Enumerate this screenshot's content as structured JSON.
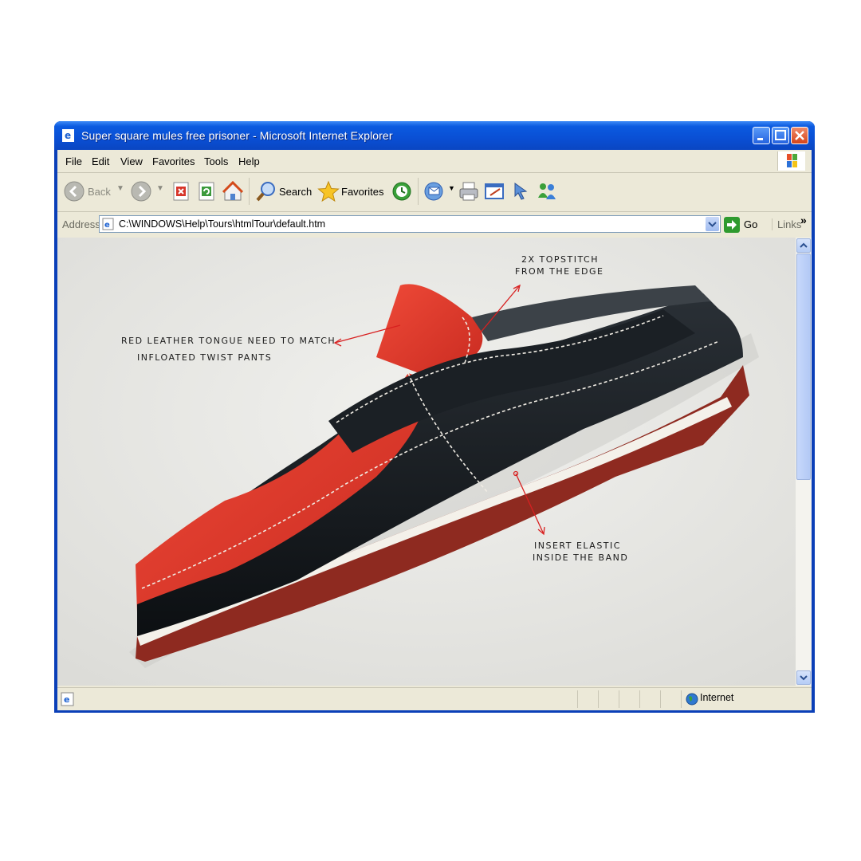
{
  "window": {
    "title": "Super square mules free prisoner - Microsoft Internet Explorer"
  },
  "menu": [
    "File",
    "Edit",
    "View",
    "Favorites",
    "Tools",
    "Help"
  ],
  "toolbar": {
    "back_label": "Back",
    "search_label": "Search",
    "favorites_label": "Favorites"
  },
  "address": {
    "label": "Address",
    "value": "C:\\WINDOWS\\Help\\Tours\\htmlTour\\default.htm",
    "go_label": "Go",
    "links_label": "Links"
  },
  "annotations": {
    "topstitch_1": "2X TOPSTITCH",
    "topstitch_2": "FROM THE EDGE",
    "tongue_1": "RED LEATHER TONGUE NEED TO MATCH",
    "tongue_2": "INFLOATED TWIST PANTS",
    "elastic_1": "INSERT ELASTIC",
    "elastic_2": "INSIDE THE BAND"
  },
  "status": {
    "zone": "Internet"
  },
  "colors": {
    "titlebar": "#0a4fd4",
    "chrome": "#ece9d8",
    "shoe_red": "#e0342a",
    "shoe_black": "#14181c",
    "sole": "#9a2c22",
    "annotation_arrow": "#d82020"
  },
  "icons": [
    "ie-icon",
    "minimize-icon",
    "maximize-icon",
    "close-icon",
    "windows-flag-icon",
    "back-icon",
    "forward-icon",
    "stop-icon",
    "refresh-icon",
    "home-icon",
    "search-icon",
    "favorites-star-icon",
    "history-icon",
    "mail-icon",
    "print-icon",
    "edit-icon",
    "messenger-icon",
    "go-arrow-icon",
    "globe-icon"
  ]
}
